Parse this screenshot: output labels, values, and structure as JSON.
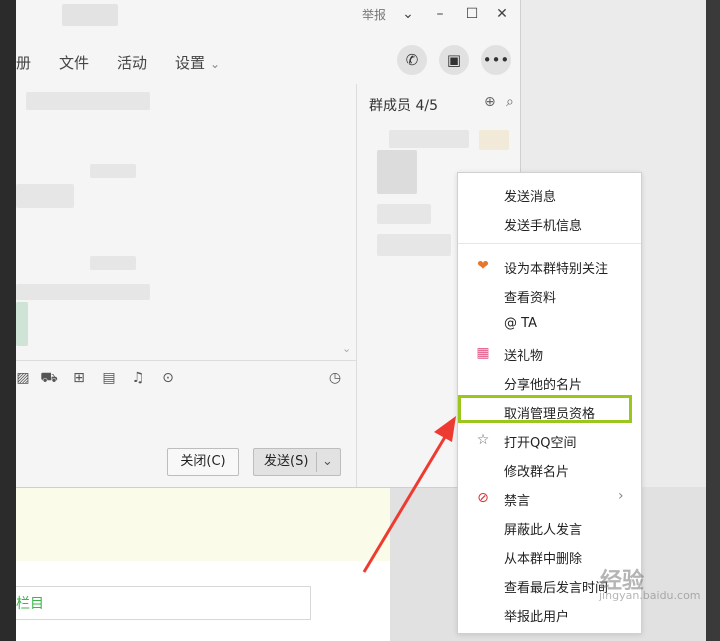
{
  "titlebar": {
    "report_label": "举报",
    "chevron_icon": "chevron-down-icon",
    "minimize_icon": "minimize-icon",
    "maximize_icon": "maximize-icon",
    "close_icon": "close-icon"
  },
  "tabs": {
    "album": "册",
    "files": "文件",
    "activity": "活动",
    "settings": "设置"
  },
  "header_buttons": [
    "phone-icon",
    "apps-icon",
    "more-icon"
  ],
  "members": {
    "title": "群成员 4/5"
  },
  "toolbar_icons": [
    "image-icon",
    "shop-icon",
    "gift-icon",
    "calendar-icon",
    "bell-icon",
    "more-circle-icon",
    "clock-icon"
  ],
  "footer": {
    "close_label": "关闭(C)",
    "send_label": "发送(S)"
  },
  "bottom_panel": {
    "column_text": "栏目"
  },
  "context_menu": {
    "items": [
      {
        "label": "发送消息",
        "icon": ""
      },
      {
        "label": "发送手机信息",
        "icon": ""
      },
      {
        "label": "设为本群特别关注",
        "icon": "special-follow-icon"
      },
      {
        "label": "查看资料",
        "icon": ""
      },
      {
        "label": "@ TA",
        "icon": ""
      },
      {
        "label": "送礼物",
        "icon": "gift-icon"
      },
      {
        "label": "分享他的名片",
        "icon": ""
      },
      {
        "label": "取消管理员资格",
        "icon": ""
      },
      {
        "label": "打开QQ空间",
        "icon": "star-icon"
      },
      {
        "label": "修改群名片",
        "icon": ""
      },
      {
        "label": "禁言",
        "icon": "mute-icon"
      },
      {
        "label": "屏蔽此人发言",
        "icon": ""
      },
      {
        "label": "从本群中删除",
        "icon": ""
      },
      {
        "label": "查看最后发言时间",
        "icon": ""
      },
      {
        "label": "举报此用户",
        "icon": ""
      }
    ]
  },
  "watermark": {
    "text": "经验",
    "sub": "jingyan.baidu.com"
  },
  "colors": {
    "highlight": "#9bc61e",
    "arrow": "#ee3b32",
    "green_text": "#3bb54a"
  }
}
